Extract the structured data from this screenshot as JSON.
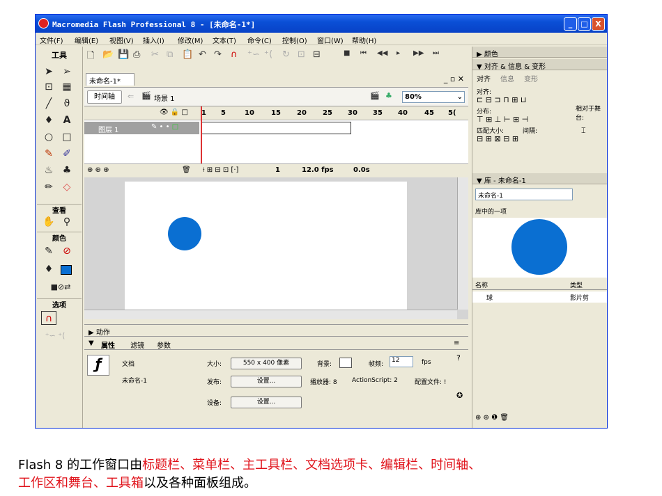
{
  "window": {
    "title": "Macromedia Flash Professional 8 - [未命名-1*]",
    "min": "_",
    "max": "□",
    "close": "X"
  },
  "menu": [
    "文件(F)",
    "编辑(E)",
    "视图(V)",
    "插入(I)",
    "修改(M)",
    "文本(T)",
    "命令(C)",
    "控制(O)",
    "窗口(W)",
    "帮助(H)"
  ],
  "tools": {
    "title": "工具",
    "view": "查看",
    "colors": "颜色",
    "options": "选项"
  },
  "document": {
    "tab": "未命名-1*",
    "timeline_button": "时间轴",
    "scene": "场景 1",
    "zoom": "80%",
    "layer": "图层 1",
    "frame": "1",
    "fps": "12.0 fps",
    "time": "0.0s",
    "ruler": [
      "1",
      "5",
      "10",
      "15",
      "20",
      "25",
      "30",
      "35",
      "40",
      "45",
      "5("
    ]
  },
  "actions_panel": "▶ 动作",
  "properties": {
    "tabs": [
      "属性",
      "滤镜",
      "参数"
    ],
    "doc_label": "文档",
    "doc_name": "未命名-1",
    "size_label": "大小:",
    "size_value": "550 x 400 像素",
    "bg_label": "背景:",
    "fps_label": "帧频:",
    "fps_value": "12",
    "fps_unit": "fps",
    "publish_label": "发布:",
    "settings_btn": "设置...",
    "player": "播放器: 8",
    "actionscript": "ActionScript: 2",
    "profile": "配置文件: !",
    "device_label": "设备:"
  },
  "right_panels": {
    "color": "▶ 颜色",
    "align_header": "▼ 对齐 & 信息 & 变形",
    "align_tabs": [
      "对齐",
      "信息",
      "变形"
    ],
    "align": "对齐:",
    "distribute": "分布:",
    "match": "匹配大小:",
    "spacing": "间隔:",
    "relative": "相对于舞台:",
    "library_header": "▼ 库 - 未命名-1",
    "library_doc": "未命名-1",
    "library_count": "库中的一项",
    "col_name": "名称",
    "col_type": "类型",
    "item_name": "球",
    "item_type": "影片剪"
  },
  "caption": {
    "p1": "Flash 8 的工作窗口由",
    "red1": "标题栏、菜单栏、主工具栏、文档选项卡、编辑栏、时间轴、",
    "red2": "工作区和舞台、工具箱",
    "p2": "以及各种面板组成。"
  },
  "colors": {
    "title_bar": "#0a4fd6",
    "ball": "#0a6fd2",
    "caption_highlight": "#e0121a"
  }
}
